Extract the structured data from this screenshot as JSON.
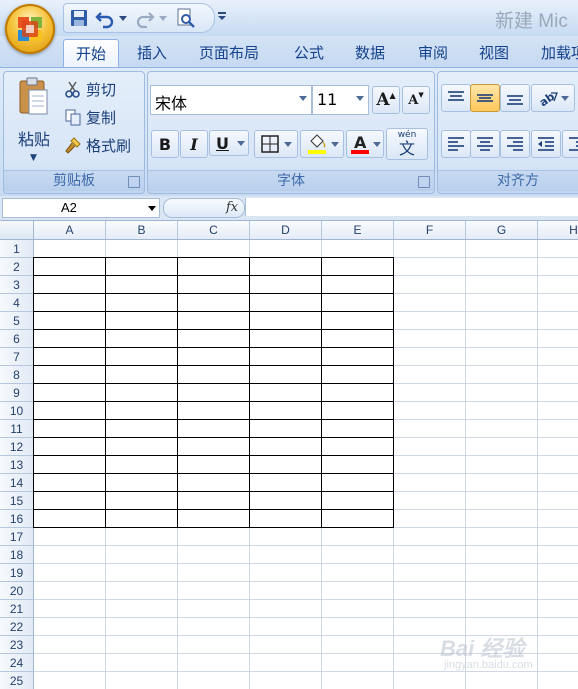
{
  "window": {
    "title": "新建 Mic"
  },
  "quick_access": {
    "icons": [
      "save-icon",
      "undo-icon",
      "redo-icon",
      "print-preview-icon",
      "customize-qat-icon"
    ]
  },
  "tabs": [
    {
      "label": "开始",
      "active": true
    },
    {
      "label": "插入"
    },
    {
      "label": "页面布局"
    },
    {
      "label": "公式"
    },
    {
      "label": "数据"
    },
    {
      "label": "审阅"
    },
    {
      "label": "视图"
    },
    {
      "label": "加载项"
    }
  ],
  "ribbon": {
    "clipboard": {
      "label": "剪贴板",
      "paste": "粘贴",
      "cut": "剪切",
      "copy": "复制",
      "format_painter": "格式刷"
    },
    "font": {
      "label": "字体",
      "font_name": "宋体",
      "font_size": "11",
      "bold": "B",
      "italic": "I",
      "underline": "U",
      "grow": "A",
      "shrink": "A",
      "phonetic": "wén",
      "phonetic_char": "文",
      "highlight_color": "#ffff00",
      "font_color": "#ff0000"
    },
    "alignment": {
      "label": "对齐方"
    }
  },
  "formula_bar": {
    "name_box": "A2",
    "fx": "fx",
    "formula": ""
  },
  "sheet": {
    "columns": [
      "A",
      "B",
      "C",
      "D",
      "E",
      "F",
      "G",
      "H"
    ],
    "rows": [
      "1",
      "2",
      "3",
      "4",
      "5",
      "6",
      "7",
      "8",
      "9",
      "10",
      "11",
      "12",
      "13",
      "14",
      "15",
      "16",
      "17",
      "18",
      "19",
      "20",
      "21",
      "22",
      "23",
      "24",
      "25"
    ],
    "bordered_range": "A2:E16"
  },
  "watermark": {
    "text": "Bai 经验",
    "sub": "jingyan.baidu.com"
  }
}
